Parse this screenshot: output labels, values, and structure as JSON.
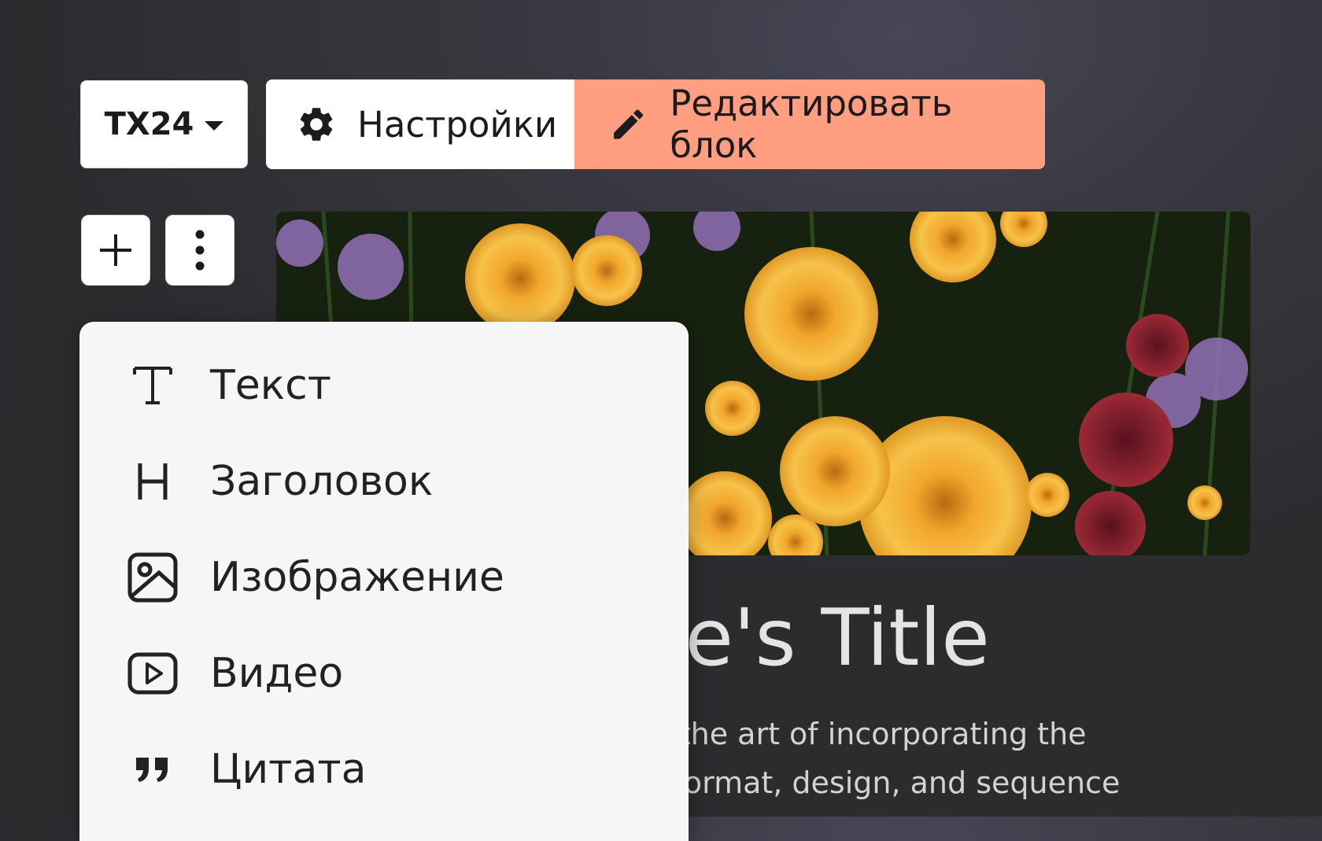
{
  "toolbar": {
    "template_label": "TX24",
    "settings_label": "Настройки",
    "edit_label": "Редактировать блок"
  },
  "block_controls": {
    "add_icon": "plus-icon",
    "more_icon": "vertical-dots-icon"
  },
  "insert_menu": {
    "items": [
      {
        "label": "Текст",
        "icon": "text-icon"
      },
      {
        "label": "Заголовок",
        "icon": "heading-icon"
      },
      {
        "label": "Изображение",
        "icon": "image-icon"
      },
      {
        "label": "Видео",
        "icon": "video-icon"
      },
      {
        "label": "Цитата",
        "icon": "quote-icon"
      }
    ]
  },
  "article": {
    "title_visible": "icle's Title",
    "body_lines_visible": [
      "gn is the art of incorporating the",
      "tyle, format, design, and sequence"
    ]
  },
  "colors": {
    "accent": "#ff9e80",
    "background": "#38373f",
    "menu_background": "#f6f6f6"
  }
}
